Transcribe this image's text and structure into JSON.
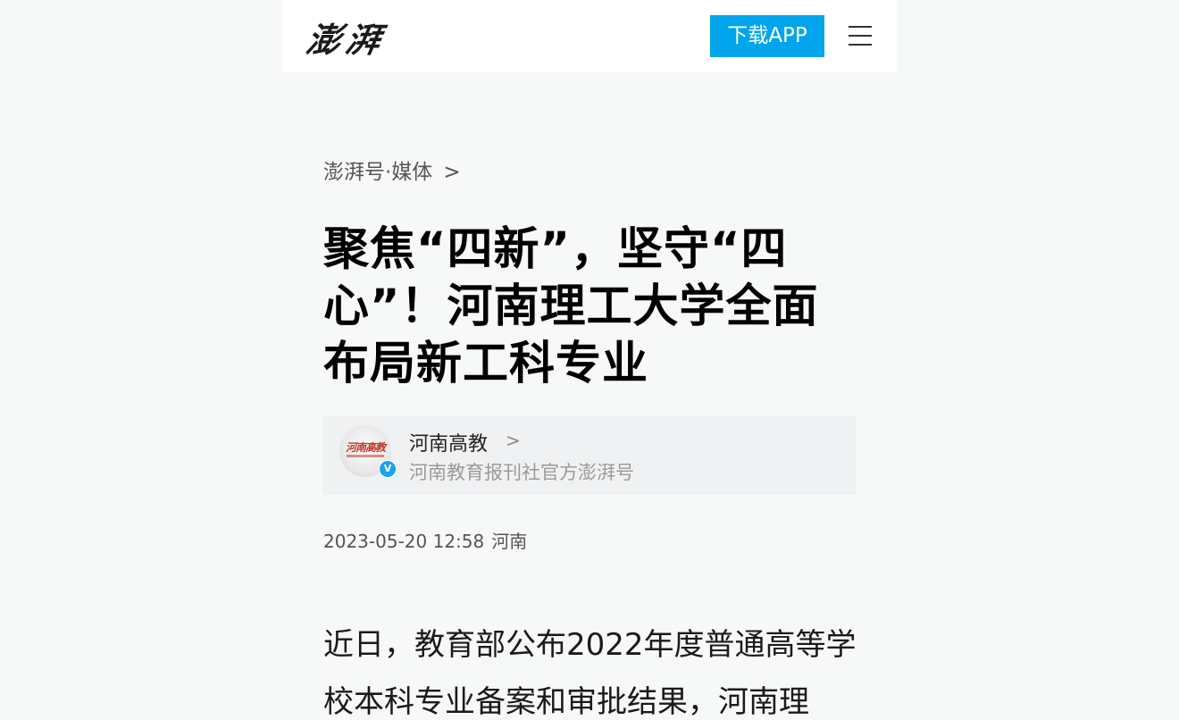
{
  "header": {
    "logo_text": "澎湃",
    "download_label": "下载APP",
    "menu_icon": "hamburger-menu-icon"
  },
  "breadcrumb": {
    "label": "澎湃号·媒体",
    "chevron": ">"
  },
  "article": {
    "title": "聚焦“四新”，坚守“四心”！河南理工大学全面布局新工科专业",
    "date": "2023-05-20 12:58",
    "location": "河南",
    "body": "近日，教育部公布2022年度普通高等学校本科专业备案和审批结果，河南理"
  },
  "author": {
    "name": "河南高教",
    "chevron": ">",
    "description": "河南教育报刊社官方澎湃号",
    "avatar_text": "河南高教",
    "verified_mark": "V"
  },
  "colors": {
    "accent": "#00a5eb",
    "page_bg": "#f7f8f8",
    "card_bg": "#f0f1f2",
    "verified": "#1da1f2"
  }
}
